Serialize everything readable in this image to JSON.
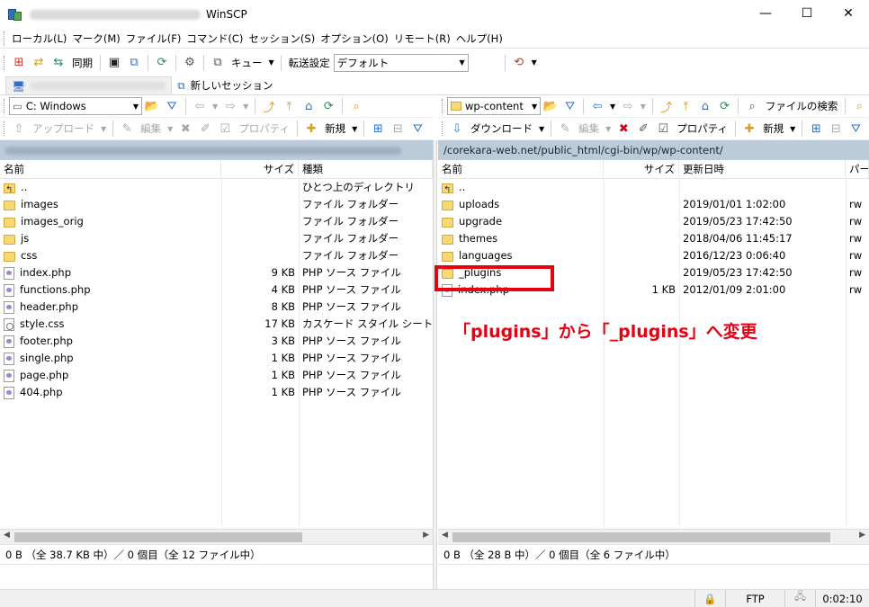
{
  "window": {
    "title": "WinSCP",
    "minimize": "—",
    "maximize": "☐",
    "close": "✕"
  },
  "menu": [
    "ローカル(L)",
    "マーク(M)",
    "ファイル(F)",
    "コマンド(C)",
    "セッション(S)",
    "オプション(O)",
    "リモート(R)",
    "ヘルプ(H)"
  ],
  "toolbar": {
    "sync_label": "同期",
    "queue_label": "キュー",
    "transfer_settings_label": "転送設定",
    "transfer_preset": "デフォルト"
  },
  "tabs": {
    "new_session": "新しいセッション"
  },
  "left": {
    "drive": "C: Windows",
    "upload": "アップロード",
    "edit": "編集",
    "properties": "プロパティ",
    "new": "新規",
    "columns": [
      "名前",
      "サイズ",
      "種類"
    ],
    "rows": [
      {
        "name": "..",
        "size": "",
        "type": "ひとつ上のディレクトリ",
        "icon": "up-folder-icon"
      },
      {
        "name": "images",
        "size": "",
        "type": "ファイル フォルダー",
        "icon": "folder-icon"
      },
      {
        "name": "images_orig",
        "size": "",
        "type": "ファイル フォルダー",
        "icon": "folder-icon"
      },
      {
        "name": "js",
        "size": "",
        "type": "ファイル フォルダー",
        "icon": "folder-icon"
      },
      {
        "name": "css",
        "size": "",
        "type": "ファイル フォルダー",
        "icon": "folder-icon"
      },
      {
        "name": "index.php",
        "size": "9 KB",
        "type": "PHP ソース ファイル",
        "icon": "php-file-icon"
      },
      {
        "name": "functions.php",
        "size": "4 KB",
        "type": "PHP ソース ファイル",
        "icon": "php-file-icon"
      },
      {
        "name": "header.php",
        "size": "8 KB",
        "type": "PHP ソース ファイル",
        "icon": "php-file-icon"
      },
      {
        "name": "style.css",
        "size": "17 KB",
        "type": "カスケード スタイル シートド...",
        "icon": "css-file-icon"
      },
      {
        "name": "footer.php",
        "size": "3 KB",
        "type": "PHP ソース ファイル",
        "icon": "php-file-icon"
      },
      {
        "name": "single.php",
        "size": "1 KB",
        "type": "PHP ソース ファイル",
        "icon": "php-file-icon"
      },
      {
        "name": "page.php",
        "size": "1 KB",
        "type": "PHP ソース ファイル",
        "icon": "php-file-icon"
      },
      {
        "name": "404.php",
        "size": "1 KB",
        "type": "PHP ソース ファイル",
        "icon": "php-file-icon"
      }
    ],
    "status": "0 B （全 38.7 KB 中）／ 0 個目（全 12 ファイル中）"
  },
  "right": {
    "folder": "wp-content",
    "download": "ダウンロード",
    "edit": "編集",
    "properties": "プロパティ",
    "new": "新規",
    "find_files": "ファイルの検索",
    "path": "/corekara-web.net/public_html/cgi-bin/wp/wp-content/",
    "columns": [
      "名前",
      "サイズ",
      "更新日時",
      "パー"
    ],
    "rows": [
      {
        "name": "..",
        "size": "",
        "modified": "",
        "perm": "",
        "icon": "up-folder-icon"
      },
      {
        "name": "uploads",
        "size": "",
        "modified": "2019/01/01 1:02:00",
        "perm": "rw",
        "icon": "folder-icon"
      },
      {
        "name": "upgrade",
        "size": "",
        "modified": "2019/05/23 17:42:50",
        "perm": "rw",
        "icon": "folder-icon"
      },
      {
        "name": "themes",
        "size": "",
        "modified": "2018/04/06 11:45:17",
        "perm": "rw",
        "icon": "folder-icon"
      },
      {
        "name": "languages",
        "size": "",
        "modified": "2016/12/23 0:06:40",
        "perm": "rw",
        "icon": "folder-icon"
      },
      {
        "name": "_plugins",
        "size": "",
        "modified": "2019/05/23 17:42:50",
        "perm": "rw",
        "icon": "folder-icon"
      },
      {
        "name": "index.php",
        "size": "1 KB",
        "modified": "2012/01/09 2:01:00",
        "perm": "rw",
        "icon": "php-file-icon"
      }
    ],
    "status": "0 B （全 28 B 中）／ 0 個目（全 6 ファイル中）"
  },
  "annotation": "「plugins」から「_plugins」へ変更",
  "statusbar": {
    "protocol": "FTP",
    "time": "0:02:10"
  },
  "colors": {
    "annotation_red": "#e60012",
    "path_bar": "#bccbd9"
  }
}
